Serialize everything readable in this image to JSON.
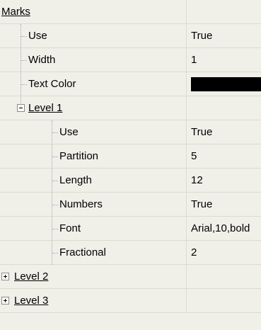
{
  "grid": {
    "rows": [
      {
        "label": "Marks",
        "value": "",
        "level": 0,
        "category": true
      },
      {
        "label": "Use",
        "value": "True",
        "level": 1
      },
      {
        "label": "Width",
        "value": "1",
        "level": 1
      },
      {
        "label": "Text Color",
        "value": "",
        "level": 1,
        "swatch": "#000000"
      },
      {
        "label": "Level 1",
        "value": "",
        "level": 1,
        "expander": "minus",
        "category": true
      },
      {
        "label": "Use",
        "value": "True",
        "level": 2
      },
      {
        "label": "Partition",
        "value": "5",
        "level": 2
      },
      {
        "label": "Length",
        "value": "12",
        "level": 2
      },
      {
        "label": "Numbers",
        "value": "True",
        "level": 2
      },
      {
        "label": "Font",
        "value": "Arial,10,bold",
        "level": 2
      },
      {
        "label": "Fractional",
        "value": "2",
        "level": 2
      },
      {
        "label": "Level 2",
        "value": "",
        "level": 1,
        "expander": "plus",
        "category": true
      },
      {
        "label": "Level 3",
        "value": "",
        "level": 1,
        "expander": "plus",
        "category": true
      }
    ]
  }
}
